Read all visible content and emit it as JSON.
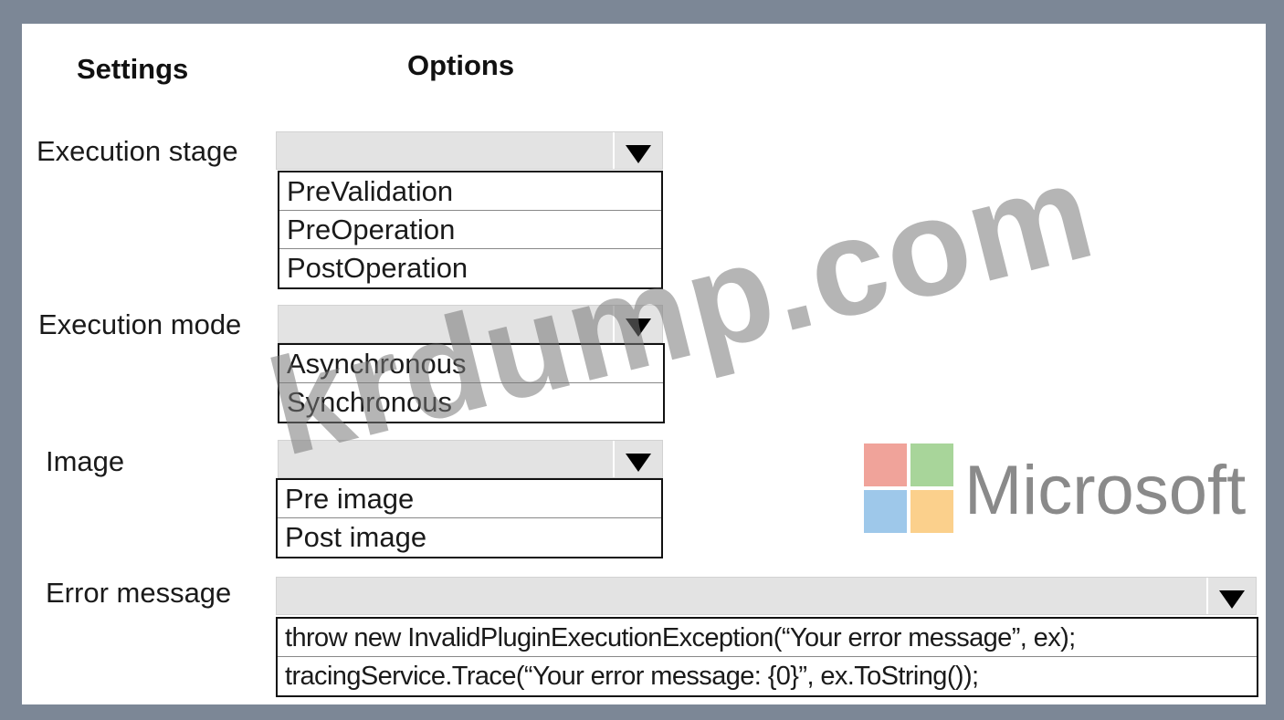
{
  "headers": {
    "settings": "Settings",
    "options": "Options"
  },
  "rows": {
    "execution_stage": {
      "label": "Execution stage",
      "options": [
        "PreValidation",
        "PreOperation",
        "PostOperation"
      ]
    },
    "execution_mode": {
      "label": "Execution mode",
      "options": [
        "Asynchronous",
        "Synchronous"
      ]
    },
    "image": {
      "label": "Image",
      "options": [
        "Pre image",
        "Post image"
      ]
    },
    "error_message": {
      "label": "Error message",
      "options": [
        "throw new InvalidPluginExecutionException(“Your error message”, ex);",
        "tracingService.Trace(“Your error message: {0}”, ex.ToString());"
      ]
    }
  },
  "dropdown_icon": "triangle-down-icon",
  "watermark": "krdump.com",
  "logo": {
    "text": "Microsoft",
    "colors": [
      "#f0a39a",
      "#a8d59a",
      "#9ec8ea",
      "#fbd08c"
    ]
  }
}
